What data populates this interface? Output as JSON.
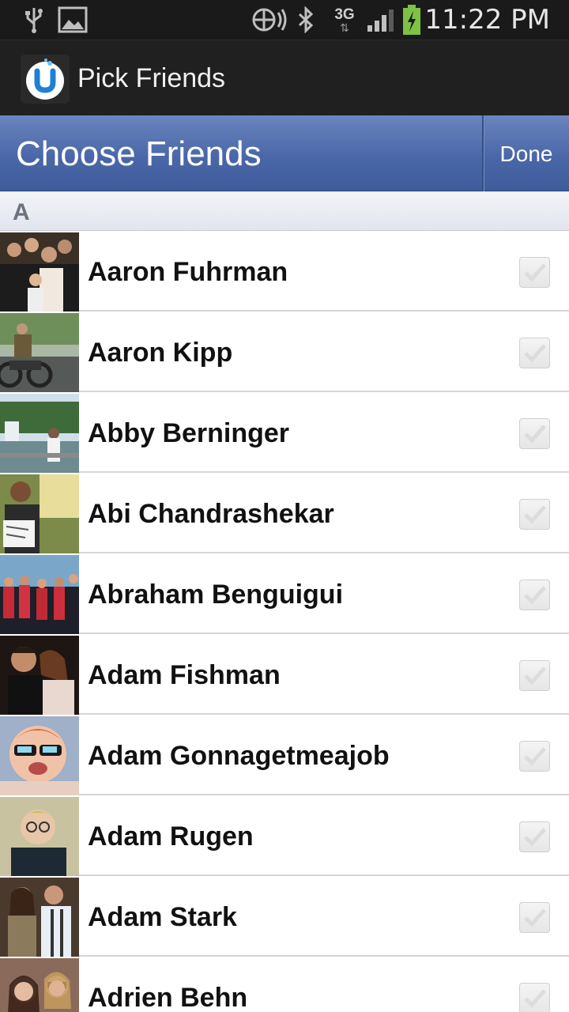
{
  "status_bar": {
    "time": "11:22 PM",
    "network": "3G",
    "icons": [
      "usb-icon",
      "image-icon",
      "nfc-icon",
      "bluetooth-icon",
      "3g-icon",
      "signal-icon",
      "battery-charging-icon"
    ]
  },
  "app_bar": {
    "title": "Pick Friends",
    "logo_icon": "app-logo-u-icon"
  },
  "picker_header": {
    "title": "Choose Friends",
    "done_label": "Done",
    "accent_color": "#4a67a8"
  },
  "section": {
    "letter": "A"
  },
  "friends": [
    {
      "name": "Aaron Fuhrman",
      "checked": false
    },
    {
      "name": "Aaron Kipp",
      "checked": false
    },
    {
      "name": "Abby Berninger",
      "checked": false
    },
    {
      "name": "Abi Chandrashekar",
      "checked": false
    },
    {
      "name": "Abraham Benguigui",
      "checked": false
    },
    {
      "name": "Adam Fishman",
      "checked": false
    },
    {
      "name": "Adam Gonnagetmeajob",
      "checked": false
    },
    {
      "name": "Adam Rugen",
      "checked": false
    },
    {
      "name": "Adam Stark",
      "checked": false
    },
    {
      "name": "Adrien Behn",
      "checked": false
    }
  ]
}
